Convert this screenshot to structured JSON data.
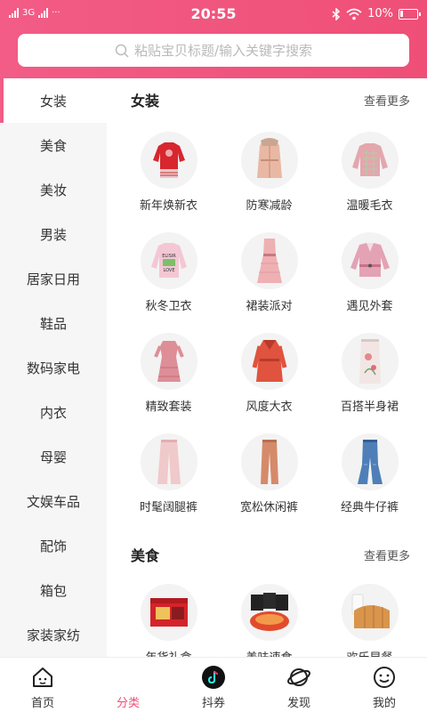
{
  "status_bar": {
    "network": "3G",
    "time": "20:55",
    "battery": "10%"
  },
  "search": {
    "placeholder": "粘贴宝贝标题/输入关键字搜索"
  },
  "sidebar": {
    "active_index": 0,
    "items": [
      {
        "label": "女装"
      },
      {
        "label": "美食"
      },
      {
        "label": "美妆"
      },
      {
        "label": "男装"
      },
      {
        "label": "居家日用"
      },
      {
        "label": "鞋品"
      },
      {
        "label": "数码家电"
      },
      {
        "label": "内衣"
      },
      {
        "label": "母婴"
      },
      {
        "label": "文娱车品"
      },
      {
        "label": "配饰"
      },
      {
        "label": "箱包"
      },
      {
        "label": "家装家纺"
      }
    ]
  },
  "sections": [
    {
      "title": "女装",
      "more": "查看更多",
      "items": [
        {
          "label": "新年焕新衣",
          "icon": "red-sweater-icon"
        },
        {
          "label": "防寒减龄",
          "icon": "beige-coat-icon"
        },
        {
          "label": "温暖毛衣",
          "icon": "pink-sweater-icon"
        },
        {
          "label": "秋冬卫衣",
          "icon": "sweatshirt-icon"
        },
        {
          "label": "裙装派对",
          "icon": "party-dress-icon"
        },
        {
          "label": "遇见外套",
          "icon": "pink-jacket-icon"
        },
        {
          "label": "精致套装",
          "icon": "pink-dress-icon"
        },
        {
          "label": "风度大衣",
          "icon": "red-coat-icon"
        },
        {
          "label": "百搭半身裙",
          "icon": "skirt-icon"
        },
        {
          "label": "时髦阔腿裤",
          "icon": "wide-pants-icon"
        },
        {
          "label": "宽松休闲裤",
          "icon": "casual-pants-icon"
        },
        {
          "label": "经典牛仔裤",
          "icon": "jeans-icon"
        }
      ]
    },
    {
      "title": "美食",
      "more": "查看更多",
      "items": [
        {
          "label": "年货礼盒",
          "icon": "gift-box-icon"
        },
        {
          "label": "美味速食",
          "icon": "instant-noodle-icon"
        },
        {
          "label": "欢乐早餐",
          "icon": "bread-milk-icon"
        }
      ]
    }
  ],
  "tabbar": {
    "active_index": 1,
    "items": [
      {
        "label": "首页",
        "icon": "home-icon"
      },
      {
        "label": "分类",
        "icon": "category-icon"
      },
      {
        "label": "抖券",
        "icon": "tiktok-icon"
      },
      {
        "label": "发现",
        "icon": "planet-icon"
      },
      {
        "label": "我的",
        "icon": "smile-icon"
      }
    ]
  },
  "colors": {
    "brand": "#ef4f77",
    "sidebar_bg": "#f6f6f6"
  }
}
